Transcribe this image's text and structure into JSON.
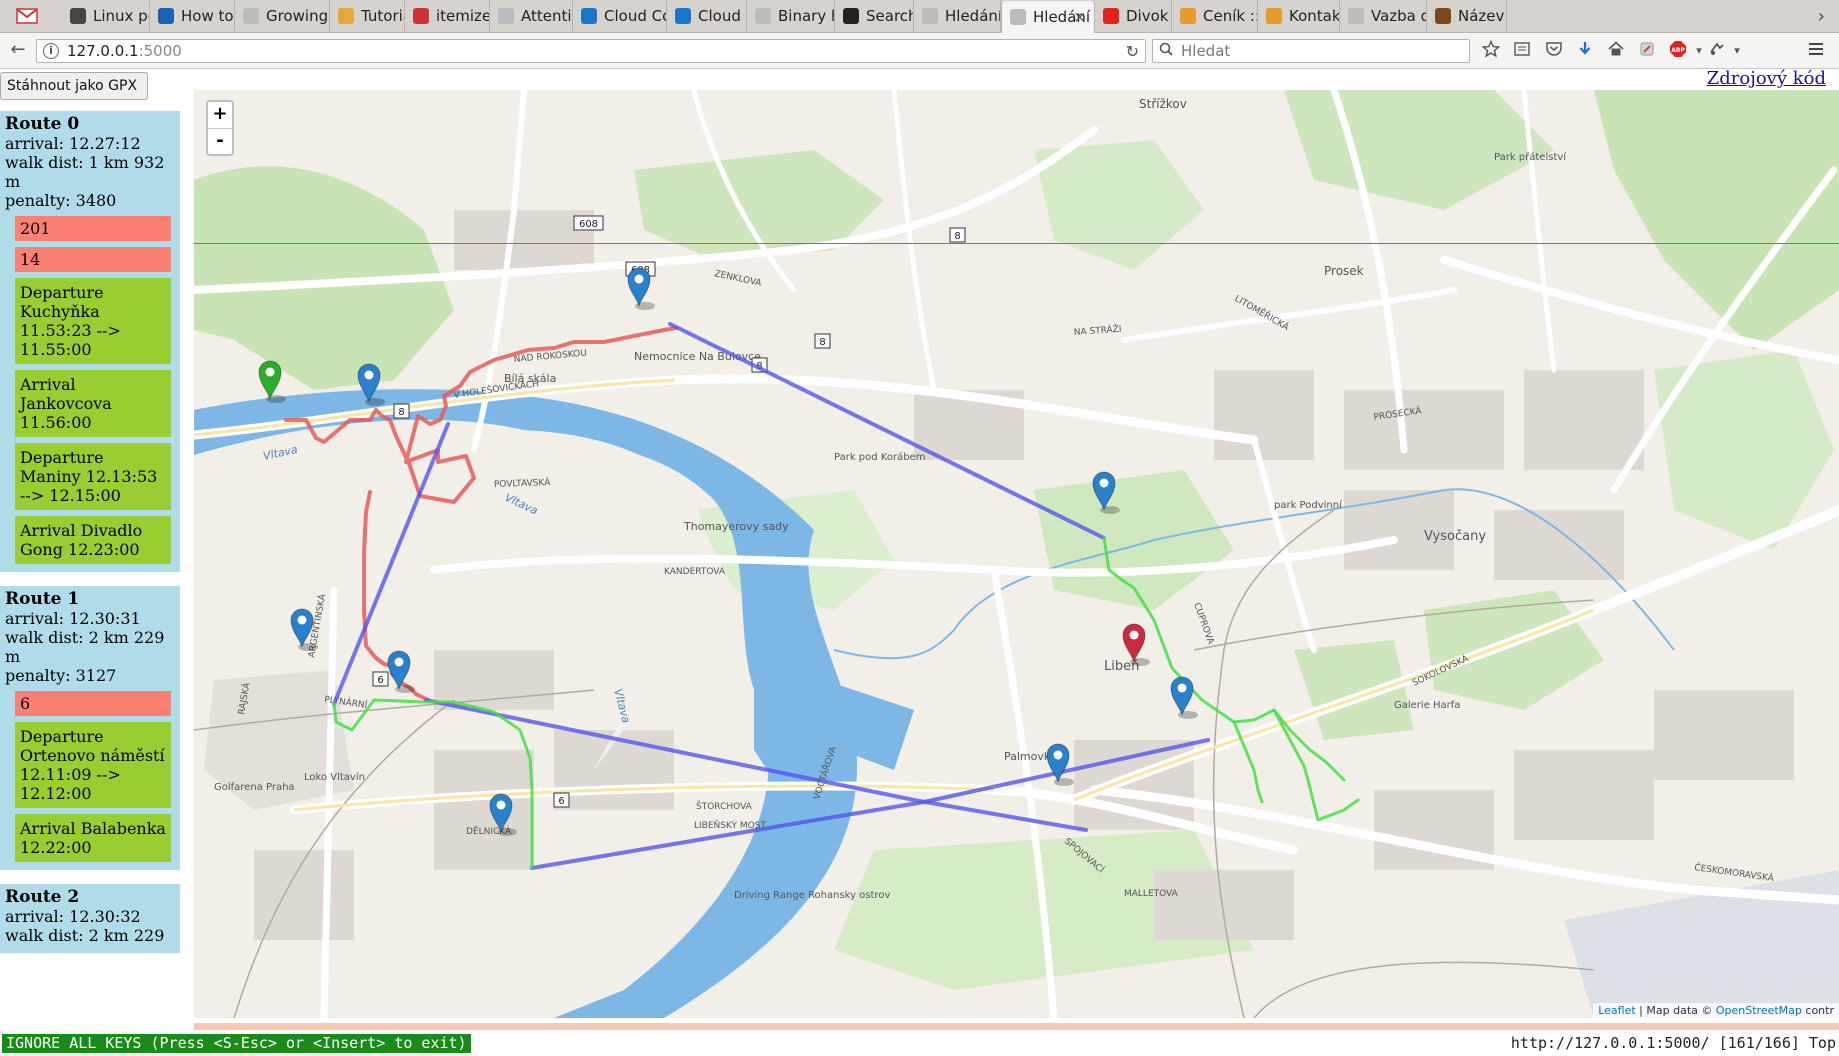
{
  "tabs": [
    {
      "title": "Linux perf E",
      "fav_color": "#444"
    },
    {
      "title": "How to p",
      "fav_color": "#1b5fb8"
    },
    {
      "title": "Growing arr",
      "fav_color": "#bbb"
    },
    {
      "title": "Tutorial",
      "fav_color": "#e8a53a"
    },
    {
      "title": "itemize",
      "fav_color": "#c33"
    },
    {
      "title": "Attention",
      "fav_color": "#bbb"
    },
    {
      "title": "Cloud Co",
      "fav_color": "#1a77c9"
    },
    {
      "title": "Cloud Co",
      "fav_color": "#1a77c9"
    },
    {
      "title": "Binary heap",
      "fav_color": "#bbb"
    },
    {
      "title": "Search ·",
      "fav_color": "#222"
    },
    {
      "title": "Hledání pěš",
      "fav_color": "#bbb"
    },
    {
      "title": "Hledání p",
      "fav_color": "#bbb",
      "active": true
    },
    {
      "title": "Divok",
      "fav_color": "#e62117"
    },
    {
      "title": "Ceník :: k",
      "fav_color": "#e89a2a"
    },
    {
      "title": "Kontakt",
      "fav_color": "#e89a2a"
    },
    {
      "title": "Vazba diplo",
      "fav_color": "#bbb"
    },
    {
      "title": "Název pr",
      "fav_color": "#7a4a1a"
    }
  ],
  "nav": {
    "url_host": "127.0.0.1",
    "url_port": ":5000",
    "search_placeholder": "Hledat",
    "back": "←",
    "reload": "↻",
    "close_tab": "×",
    "scroll_right": "›"
  },
  "page": {
    "gpx_button": "Stáhnout jako GPX",
    "source_link": "Zdrojový kód"
  },
  "routes": [
    {
      "title": "Route 0",
      "arrival": "arrival: 12.27:12",
      "walk": "walk dist: 1 km 932 m",
      "penalty": "penalty: 3480",
      "buses": [
        "201",
        "14"
      ],
      "steps": [
        "Departure Kuchyňka 11.53:23 --> 11.55:00",
        "Arrival Jankovcova 11.56:00",
        "Departure Maniny 12.13:53 --> 12.15:00",
        "Arrival Divadlo Gong 12.23:00"
      ]
    },
    {
      "title": "Route 1",
      "arrival": "arrival: 12.30:31",
      "walk": "walk dist: 2 km 229 m",
      "penalty": "penalty: 3127",
      "buses": [
        "6"
      ],
      "steps": [
        "Departure Ortenovo náměstí 12.11:09 --> 12.12:00",
        "Arrival Balabenka 12.22:00"
      ]
    },
    {
      "title": "Route 2",
      "arrival": "arrival: 12.30:32",
      "walk": "walk dist: 2 km 229",
      "penalty": "",
      "buses": [],
      "steps": []
    }
  ],
  "map": {
    "zoom_in": "+",
    "zoom_out": "-",
    "attribution_leaflet": "Leaflet",
    "attribution_text": " | Map data © ",
    "attribution_osm": "OpenStreetMap",
    "attribution_tail": " contr",
    "labels": [
      "Střížkov",
      "Prosek",
      "Vysočany",
      "Libeň",
      "Palmovka",
      "Park přátelství",
      "Bílá skála",
      "Nemocnice Na Bulovce",
      "Park pod Korábem",
      "Thomayerovy sady",
      "park Podvinní",
      "Galerie Harfa",
      "Golfarena Praha",
      "Loko Vltavín",
      "Driving Range Rohansky ostrov",
      "Vltava",
      "Vltava",
      "Vltava",
      "ZENKLOVA",
      "POVLTAVSKÁ",
      "KANDERTOVA",
      "SOKOLOVSKÁ",
      "LIBEŇSKÝ MOST",
      "ČESKOMORAVSKÁ",
      "V HOLEŠOVIČKÁCH",
      "NAD ROKOSKOU",
      "PLYNÁRNÍ",
      "ARGENTINSKÁ",
      "CUPROVA",
      "DĚLNICKÁ",
      "PROSECKÁ",
      "NA STRÁŽI",
      "LITOMĚŘICKÁ",
      "SPOJOVACÍ",
      "MALLETOVA",
      "ŠTORCHOVA",
      "VOCTÁŘOVA",
      "RAJSKÁ"
    ],
    "shields": [
      "608",
      "608",
      "8",
      "8",
      "8",
      "8",
      "6",
      "6"
    ]
  },
  "statusline": {
    "mode": "IGNORE ALL KEYS (Press <S-Esc> or <Insert> to exit)",
    "url": "http://127.0.0.1:5000/ [161/166] Top"
  },
  "colors": {
    "route_blue": "#5555ee",
    "route_red": "#e85a5a",
    "route_green": "#44e044",
    "bus_pill": "#fa8072",
    "step_pill": "#9acd32",
    "route_card": "#b0dbe8",
    "water": "#7db7e6"
  }
}
